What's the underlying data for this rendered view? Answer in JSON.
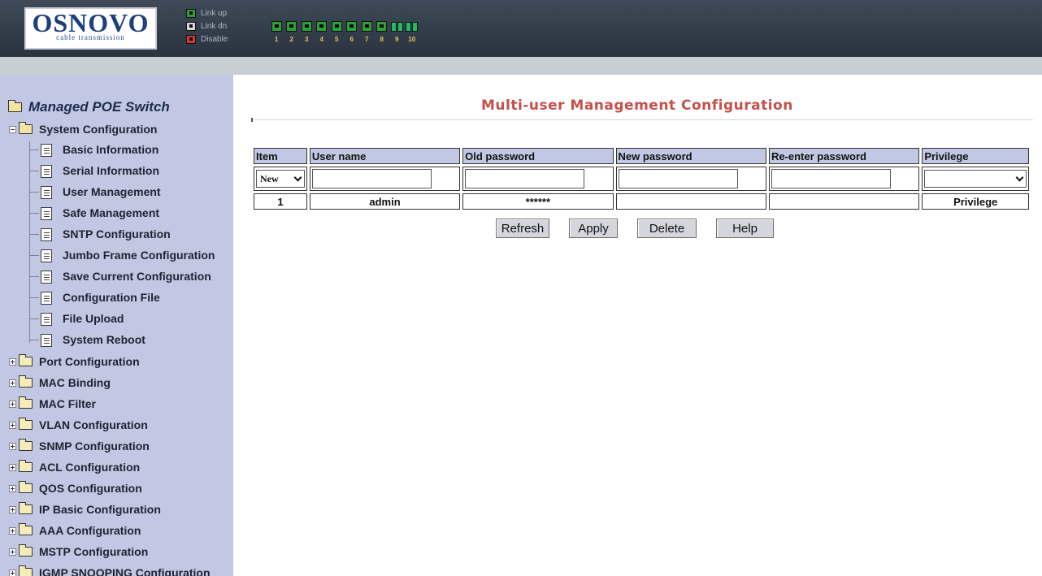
{
  "header": {
    "logo_main": "OSNOVO",
    "logo_sub": "cable transmission",
    "legend": [
      "Link up",
      "Link dn",
      "Disable"
    ],
    "ports": [
      "1",
      "2",
      "3",
      "4",
      "5",
      "6",
      "7",
      "8",
      "9",
      "10"
    ]
  },
  "sidebar": {
    "root": "Managed POE Switch",
    "open_category": "System Configuration",
    "leaves": [
      "Basic Information",
      "Serial Information",
      "User Management",
      "Safe Management",
      "SNTP Configuration",
      "Jumbo Frame Configuration",
      "Save Current Configuration",
      "Configuration File",
      "File Upload",
      "System Reboot"
    ],
    "categories": [
      "Port Configuration",
      "MAC Binding",
      "MAC Filter",
      "VLAN Configuration",
      "SNMP Configuration",
      "ACL Configuration",
      "QOS Configuration",
      "IP Basic Configuration",
      "AAA Configuration",
      "MSTP Configuration",
      "IGMP SNOOPING Configuration"
    ]
  },
  "main": {
    "title": "Multi-user Management Configuration",
    "columns": [
      "Item",
      "User name",
      "Old password",
      "New password",
      "Re-enter password",
      "Privilege"
    ],
    "input_row": {
      "item_select": "New",
      "privilege_select": ""
    },
    "rows": [
      {
        "item": "1",
        "user_name": "admin",
        "old_password": "******",
        "new_password": "",
        "reenter_password": "",
        "privilege": "Privilege"
      }
    ],
    "buttons": {
      "refresh": "Refresh",
      "apply": "Apply",
      "delete": "Delete",
      "help": "Help"
    }
  },
  "colors": {
    "header_bg": "#2f3944",
    "sidebar_bg": "#c2c8e4",
    "title_color": "#c5504a",
    "port_green": "#2f9d3a",
    "port_label": "#e6c25a"
  }
}
